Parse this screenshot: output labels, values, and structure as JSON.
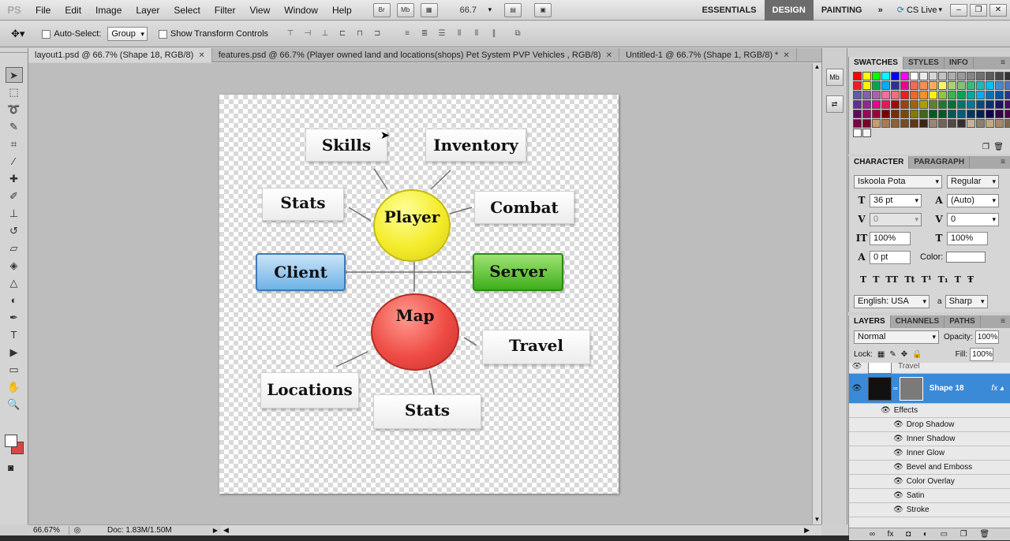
{
  "app": {
    "logo": "PS"
  },
  "menu": [
    "File",
    "Edit",
    "Image",
    "Layer",
    "Select",
    "Filter",
    "View",
    "Window",
    "Help"
  ],
  "menubar_icons": [
    "Br",
    "Mb"
  ],
  "zoom_value": "66.7",
  "workspaces": {
    "essentials": "ESSENTIALS",
    "design": "DESIGN",
    "painting": "PAINTING",
    "more": "»"
  },
  "cs_live": "CS Live",
  "options": {
    "auto_select_label": "Auto-Select:",
    "auto_select_value": "Group",
    "show_transform_label": "Show Transform Controls"
  },
  "tabs": [
    {
      "label": "layout1.psd @ 66.7% (Shape 18, RGB/8)"
    },
    {
      "label": "features.psd @ 66.7% (Player owned land and locations(shops) Pet System PVP Vehicles , RGB/8)"
    },
    {
      "label": "Untitled-1 @ 66.7% (Shape 1, RGB/8) *"
    }
  ],
  "diagram": {
    "skills": "Skills",
    "inventory": "Inventory",
    "stats_top": "Stats",
    "combat": "Combat",
    "player": "Player",
    "client": "Client",
    "server": "Server",
    "map": "Map",
    "travel": "Travel",
    "locations": "Locations",
    "stats_bottom": "Stats"
  },
  "status": {
    "zoom": "66.67%",
    "doc": "Doc: 1.83M/1.50M"
  },
  "panels": {
    "swatches_tabs": [
      "SWATCHES",
      "STYLES",
      "INFO"
    ],
    "character_tabs": [
      "CHARACTER",
      "PARAGRAPH"
    ],
    "layers_tabs": [
      "LAYERS",
      "CHANNELS",
      "PATHS"
    ]
  },
  "swatch_colors": [
    "#ff0000",
    "#ffff00",
    "#00ff00",
    "#00ffff",
    "#0000ff",
    "#ff00ff",
    "#ffffff",
    "#ebebeb",
    "#d6d6d6",
    "#c2c2c2",
    "#adadad",
    "#999999",
    "#858585",
    "#707070",
    "#5c5c5c",
    "#474747",
    "#333333",
    "#ee1d24",
    "#fff200",
    "#00a650",
    "#00aeef",
    "#2e3192",
    "#ec008c",
    "#f26c4f",
    "#f68e55",
    "#fbaf5c",
    "#fff467",
    "#acd372",
    "#7dc473",
    "#3bb878",
    "#1abbb4",
    "#00bff3",
    "#438ccb",
    "#5574b9",
    "#605ca8",
    "#8560a8",
    "#a863a8",
    "#f06eaa",
    "#f26d7d",
    "#ed1c24",
    "#f26522",
    "#f7941d",
    "#fff200",
    "#8dc63f",
    "#39b54a",
    "#00a651",
    "#00a99d",
    "#00aeef",
    "#0072bc",
    "#0054a6",
    "#2e3192",
    "#662d91",
    "#92278f",
    "#ec008c",
    "#ed145b",
    "#9e0b0f",
    "#a0410d",
    "#a36209",
    "#aba000",
    "#598527",
    "#1a7b30",
    "#007236",
    "#00746b",
    "#0076a3",
    "#004b80",
    "#003471",
    "#1b1464",
    "#440e62",
    "#630460",
    "#9e005d",
    "#9e0039",
    "#790000",
    "#7b2e00",
    "#7d4900",
    "#827b00",
    "#406618",
    "#005e20",
    "#005826",
    "#005952",
    "#005b7f",
    "#003663",
    "#002157",
    "#0d004c",
    "#32004b",
    "#4b0049",
    "#7b0046",
    "#7a0026",
    "#c69c6d",
    "#a67c52",
    "#8c6239",
    "#754c24",
    "#603913",
    "#3c2415",
    "#998675",
    "#736357",
    "#534741",
    "#362f2d",
    "#c7b299",
    "#8a7e6e",
    "#c2a983",
    "#a68a64",
    "#7d6b4f",
    "#ffffff",
    "#f5f5f5"
  ],
  "character": {
    "font_family": "Iskoola Pota",
    "font_style": "Regular",
    "font_size": "36 pt",
    "leading": "(Auto)",
    "kerning": "0",
    "tracking": "0",
    "vscale": "100%",
    "hscale": "100%",
    "baseline": "0 pt",
    "color_label": "Color:",
    "language": "English: USA",
    "aa_label": "a",
    "antialias": "Sharp"
  },
  "layers": {
    "blend": "Normal",
    "opacity_label": "Opacity:",
    "opacity": "100%",
    "lock_label": "Lock:",
    "fill_label": "Fill:",
    "fill": "100%",
    "items": [
      {
        "name": "Travel"
      },
      {
        "name": "Shape 18"
      }
    ],
    "effects_label": "Effects",
    "effects": [
      "Drop Shadow",
      "Inner Shadow",
      "Inner Glow",
      "Bevel and Emboss",
      "Color Overlay",
      "Satin",
      "Stroke"
    ]
  },
  "colors": {
    "accent": "#2e6fc7",
    "active_workspace": "#6c6c6c",
    "selected_layer": "#3b8ad8"
  }
}
